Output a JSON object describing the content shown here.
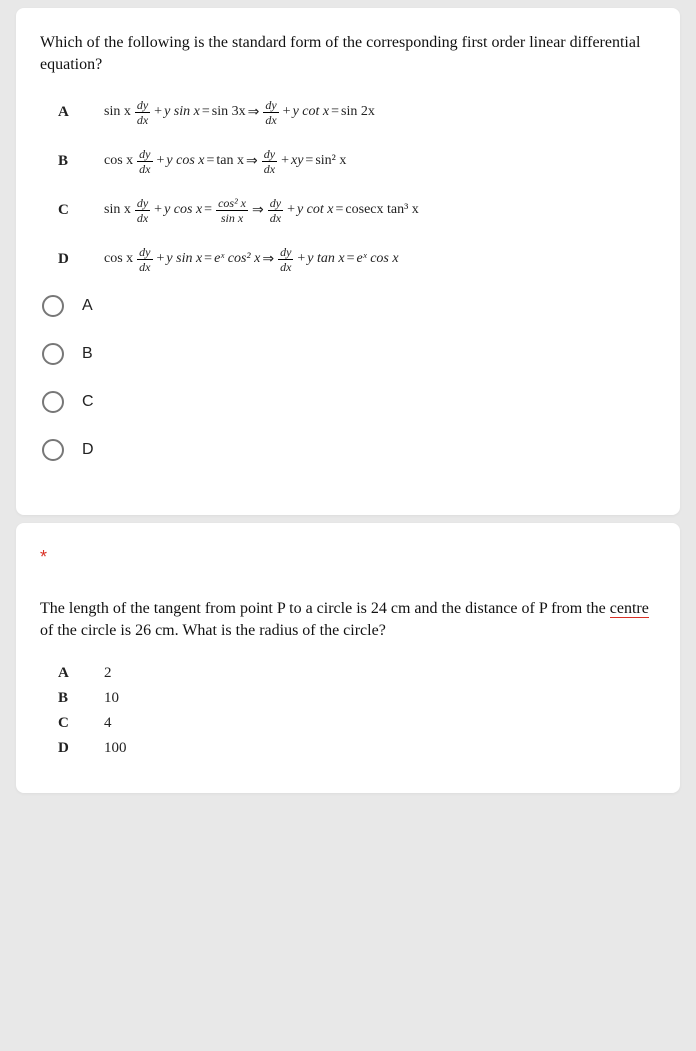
{
  "q1": {
    "prompt": "Which of the following is the standard form of the corresponding first order linear differential equation?",
    "rows": {
      "A": {
        "label": "A"
      },
      "B": {
        "label": "B"
      },
      "C": {
        "label": "C"
      },
      "D": {
        "label": "D"
      }
    },
    "options": {
      "A": "A",
      "B": "B",
      "C": "C",
      "D": "D"
    }
  },
  "q2": {
    "asterisk": "*",
    "prompt_pre": "The length of the tangent from point  P to a circle is 24 cm and the distance of  P from the ",
    "prompt_centre": "centre",
    "prompt_post": " of the circle is 26 cm. What is the radius of the circle?",
    "answers": {
      "A": {
        "label": "A",
        "val": "2"
      },
      "B": {
        "label": "B",
        "val": "10"
      },
      "C": {
        "label": "C",
        "val": "4"
      },
      "D": {
        "label": "D",
        "val": "100"
      }
    }
  },
  "math": {
    "dy": "dy",
    "dx": "dx",
    "sinx": "sin x",
    "cosx": "cos x",
    "tanx": "tan x",
    "ysinx": "y sin x",
    "ycosx": "y cos x",
    "ycotx": "y cot x",
    "ytanx": "y tan x",
    "sin3x": "sin 3x",
    "sin2x": "sin 2x",
    "xy": "xy",
    "sin2x_sq": "sin² x",
    "cos2x_sq": "cos² x",
    "sinx_den": "sin x",
    "cosecx_tan3x": "cosecx tan³ x",
    "ex": "eˣ",
    "ex_cos2x": "eˣ cos² x",
    "ex_cosx": "eˣ cos x",
    "plus": "+",
    "eq": "=",
    "imp": "⇒"
  }
}
